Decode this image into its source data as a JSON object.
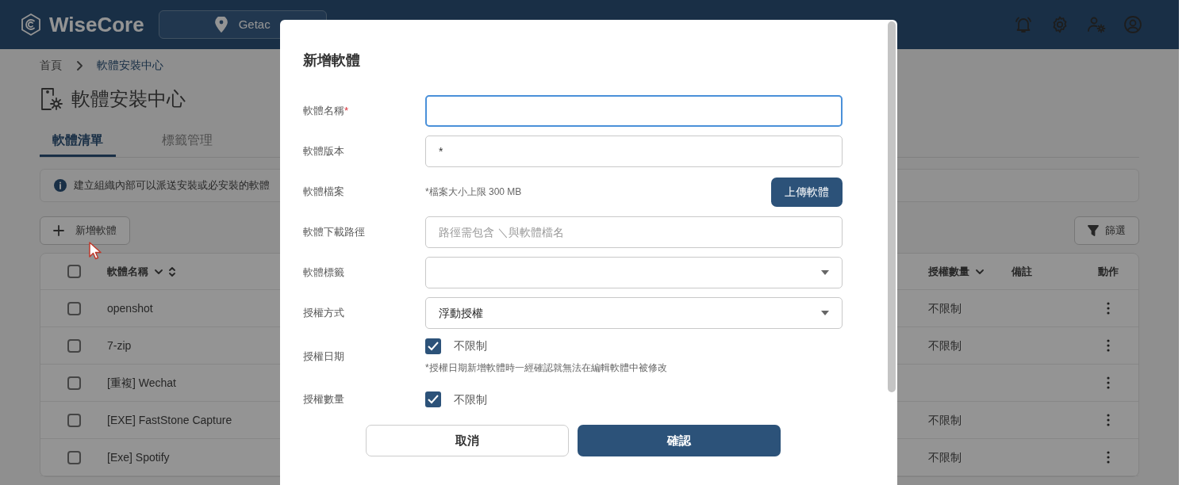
{
  "app": {
    "logo": "WiseCore",
    "location": "Getac"
  },
  "breadcrumb": [
    "首頁",
    "軟體安裝中心"
  ],
  "page_title": "軟體安裝中心",
  "tabs": [
    {
      "label": "軟體清單",
      "selected": true
    },
    {
      "label": "標籤管理",
      "selected": false
    }
  ],
  "info": "建立組織內部可以派送安裝或必安裝的軟體",
  "add_button": "新增軟體",
  "filter_button": "篩選",
  "table": {
    "select_all": false,
    "columns": [
      {
        "label": "軟體名稱",
        "dropdown": true,
        "sort": true
      },
      {
        "label": "授權數量",
        "dropdown": true,
        "sort": false
      },
      {
        "label": "備註",
        "dropdown": false,
        "sort": false
      },
      {
        "label": "動作",
        "dropdown": false,
        "sort": false
      }
    ],
    "rows": [
      {
        "name": "openshot",
        "quantity": "不限制",
        "checked": false
      },
      {
        "name": "7-zip",
        "quantity": "不限制",
        "checked": false
      },
      {
        "name": "[重複] Wechat",
        "checked": false
      },
      {
        "name": "[EXE] FastStone Capture",
        "quantity": "不限制",
        "checked": false
      },
      {
        "name": "[Exe] Spotify",
        "quantity": "不限制",
        "checked": false
      }
    ]
  },
  "dialog": {
    "title": "新增軟體",
    "fields": [
      {
        "kind": "text",
        "label": "軟體名稱",
        "required_mark": "*",
        "focused": true
      },
      {
        "kind": "text",
        "label": "軟體版本",
        "value": "*",
        "focused": false
      },
      {
        "kind": "file",
        "label": "軟體檔案",
        "note": "*檔案大小上限 300 MB",
        "button": "上傳軟體"
      },
      {
        "kind": "text",
        "label": "軟體下載路徑",
        "placeholder": "路徑需包含 ＼與軟體檔名",
        "focused": false
      },
      {
        "kind": "select",
        "label": "軟體標籤"
      },
      {
        "kind": "select",
        "label": "授權方式",
        "value": "浮動授權"
      },
      {
        "kind": "checkbox",
        "label": "授權日期",
        "checked": true,
        "option": "不限制",
        "note": "*授權日期新增軟體時一經確認就無法在編輯軟體中被修改"
      },
      {
        "kind": "checkbox",
        "label": "授權數量",
        "checked": true,
        "option": "不限制"
      }
    ],
    "actions": [
      {
        "label": "取消",
        "primary": false
      },
      {
        "label": "確認",
        "primary": true
      }
    ]
  }
}
